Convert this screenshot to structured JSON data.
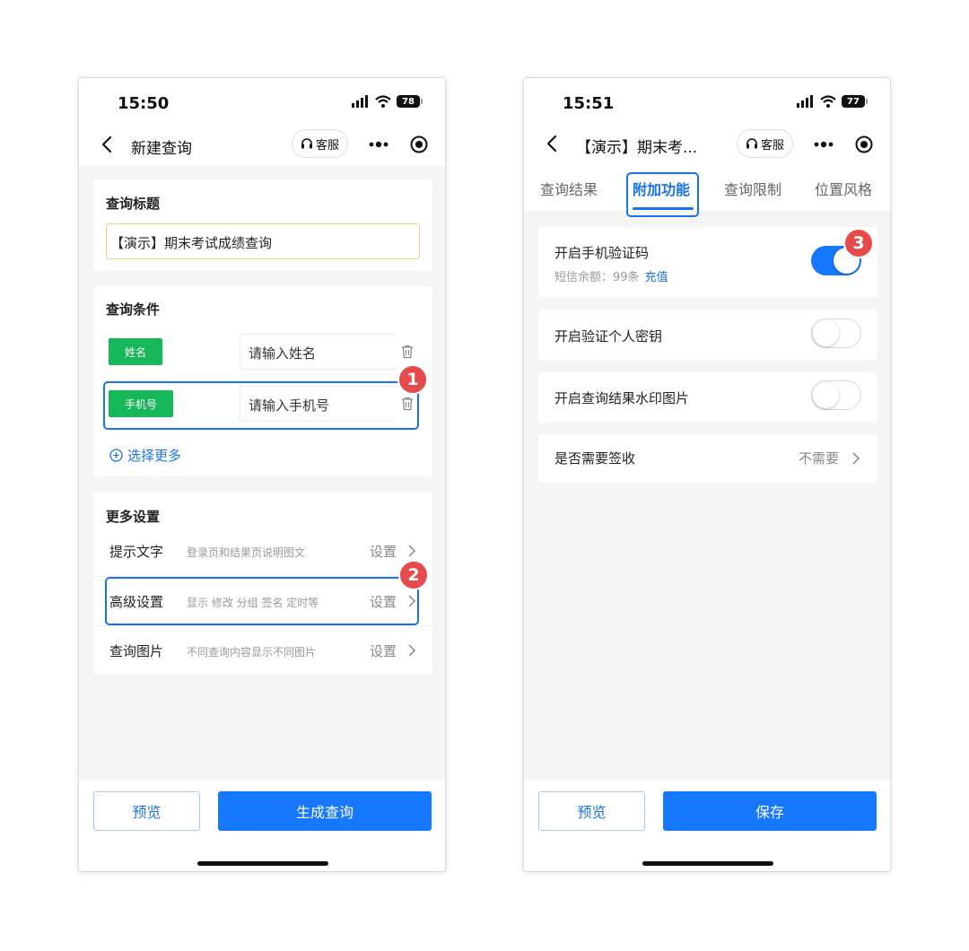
{
  "left": {
    "status": {
      "time": "15:50",
      "battery": "78"
    },
    "nav": {
      "title": "新建查询",
      "kefu": "客服"
    },
    "query_title": {
      "heading": "查询标题",
      "value": "【演示】期末考试成绩查询"
    },
    "conditions": {
      "heading": "查询条件",
      "items": [
        {
          "tag": "姓名",
          "placeholder": "请输入姓名"
        },
        {
          "tag": "手机号",
          "placeholder": "请输入手机号"
        }
      ],
      "add_more": "选择更多"
    },
    "more_settings": {
      "heading": "更多设置",
      "rows": [
        {
          "label": "提示文字",
          "desc": "登录页和结果页说明图文",
          "action": "设置"
        },
        {
          "label": "高级设置",
          "desc": "显示 修改 分组 签名 定时等",
          "action": "设置"
        },
        {
          "label": "查询图片",
          "desc": "不同查询内容显示不同图片",
          "action": "设置"
        }
      ]
    },
    "buttons": {
      "preview": "预览",
      "generate": "生成查询"
    },
    "badges": [
      "1",
      "2"
    ]
  },
  "right": {
    "status": {
      "time": "15:51",
      "battery": "77"
    },
    "nav": {
      "title": "【演示】期末考...",
      "kefu": "客服"
    },
    "tabs": [
      "查询结果",
      "附加功能",
      "查询限制",
      "位置风格"
    ],
    "active_tab": 1,
    "features": {
      "sms": {
        "label": "开启手机验证码",
        "sub": "短信余额：99条",
        "link": "充值",
        "enabled": true
      },
      "key": {
        "label": "开启验证个人密钥",
        "enabled": false
      },
      "watermark": {
        "label": "开启查询结果水印图片",
        "enabled": false
      },
      "sign": {
        "label": "是否需要签收",
        "value": "不需要"
      }
    },
    "buttons": {
      "preview": "预览",
      "save": "保存"
    },
    "badges": [
      "3"
    ]
  },
  "colors": {
    "accent": "#1677ff",
    "highlight": "#1a73e8",
    "tag_green": "#16b85a",
    "badge_red": "#e64a4a",
    "input_border_focus": "#f2d27d"
  },
  "icons": [
    "back-icon",
    "headset-icon",
    "more-dots-icon",
    "record-icon",
    "signal-icon",
    "wifi-icon",
    "battery-icon",
    "trash-icon",
    "plus-circle-icon",
    "chevron-right-icon"
  ]
}
